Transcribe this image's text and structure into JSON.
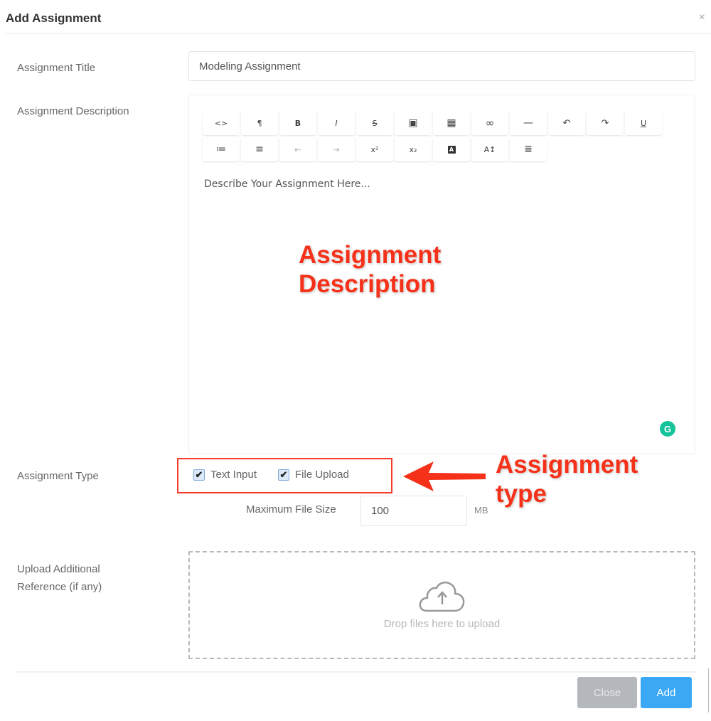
{
  "modal": {
    "title": "Add Assignment",
    "close_glyph": "×"
  },
  "form": {
    "title_label": "Assignment Title",
    "title_value": "Modeling Assignment",
    "description_label": "Assignment Description",
    "description_placeholder": "Describe Your Assignment Here...",
    "type_label": "Assignment Type",
    "type_options": [
      {
        "label": "Text Input",
        "checked": true
      },
      {
        "label": "File Upload",
        "checked": true
      }
    ],
    "max_file_size_label": "Maximum File Size",
    "max_file_size_value": "100",
    "max_file_size_unit": "MB",
    "upload_label_line1": "Upload Additional",
    "upload_label_line2": "Reference (if any)",
    "dropzone_text": "Drop files here to upload"
  },
  "editor_toolbar": {
    "row1": [
      {
        "icon": "code-view-icon",
        "glyph": "<>"
      },
      {
        "icon": "paragraph-icon",
        "glyph": "¶"
      },
      {
        "icon": "bold-icon",
        "glyph": "B"
      },
      {
        "icon": "italic-icon",
        "glyph": "I"
      },
      {
        "icon": "strikethrough-icon",
        "glyph": "S"
      },
      {
        "icon": "image-icon",
        "glyph": "▣"
      },
      {
        "icon": "table-icon",
        "glyph": "▦"
      },
      {
        "icon": "link-icon",
        "glyph": "∞"
      },
      {
        "icon": "horizontal-rule-icon",
        "glyph": "—"
      },
      {
        "icon": "undo-icon",
        "glyph": "↶"
      },
      {
        "icon": "redo-icon",
        "glyph": "↷"
      },
      {
        "icon": "underline-icon",
        "glyph": "U"
      }
    ],
    "row2": [
      {
        "icon": "ordered-list-icon",
        "glyph": "≔"
      },
      {
        "icon": "unordered-list-icon",
        "glyph": "≡"
      },
      {
        "icon": "outdent-icon",
        "glyph": "⇤"
      },
      {
        "icon": "indent-icon",
        "glyph": "⇥"
      },
      {
        "icon": "superscript-icon",
        "glyph": "x²"
      },
      {
        "icon": "subscript-icon",
        "glyph": "x₂"
      },
      {
        "icon": "text-color-icon",
        "glyph": "A"
      },
      {
        "icon": "font-size-icon",
        "glyph": "A↕"
      },
      {
        "icon": "align-icon",
        "glyph": "≣"
      }
    ]
  },
  "annotations": {
    "description_line1": "Assignment",
    "description_line2": "Description",
    "type_line1": "Assignment",
    "type_line2": "type"
  },
  "footer": {
    "close_label": "Close",
    "add_label": "Add"
  },
  "colors": {
    "annotation_red": "#f5311a",
    "add_button": "#3ba8f5",
    "close_button": "#b4b8bd",
    "grammarly": "#15c39a"
  }
}
